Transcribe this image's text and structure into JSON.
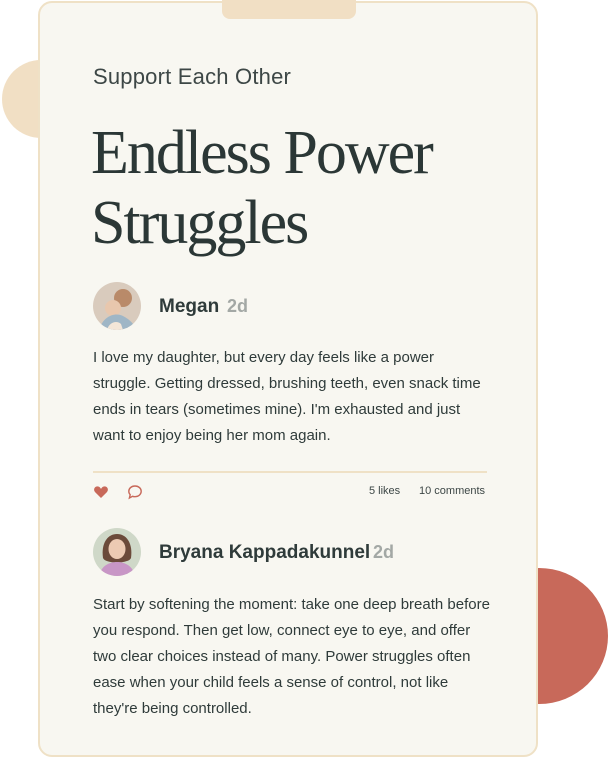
{
  "card": {
    "eyebrow": "Support Each Other",
    "title": "Endless Power Struggles"
  },
  "post": {
    "author": "Megan",
    "age": "2d",
    "text": "I love my daughter, but every day feels like a power struggle. Getting dressed, brushing teeth, even snack time ends in tears (sometimes mine). I'm exhausted and just want to enjoy being her mom again.",
    "likes_label": "5 likes",
    "comments_label": "10 comments",
    "like_icon": "heart-icon",
    "comment_icon": "speech-bubble-icon"
  },
  "reply": {
    "author": "Bryana Kappadakunnel",
    "age": "2d",
    "text": "Start by softening the moment: take one deep breath before you respond. Then get low, connect eye to eye, and offer two clear choices instead of many. Power struggles often ease when your child feels a sense of control, not like they're being controlled."
  },
  "colors": {
    "card_bg": "#f8f7f1",
    "card_border": "#efe1c6",
    "accent_terracotta": "#c8695a",
    "accent_sand": "#f1dfc4",
    "text_dark": "#2f3b3a",
    "text_muted": "#a3a8a5"
  }
}
